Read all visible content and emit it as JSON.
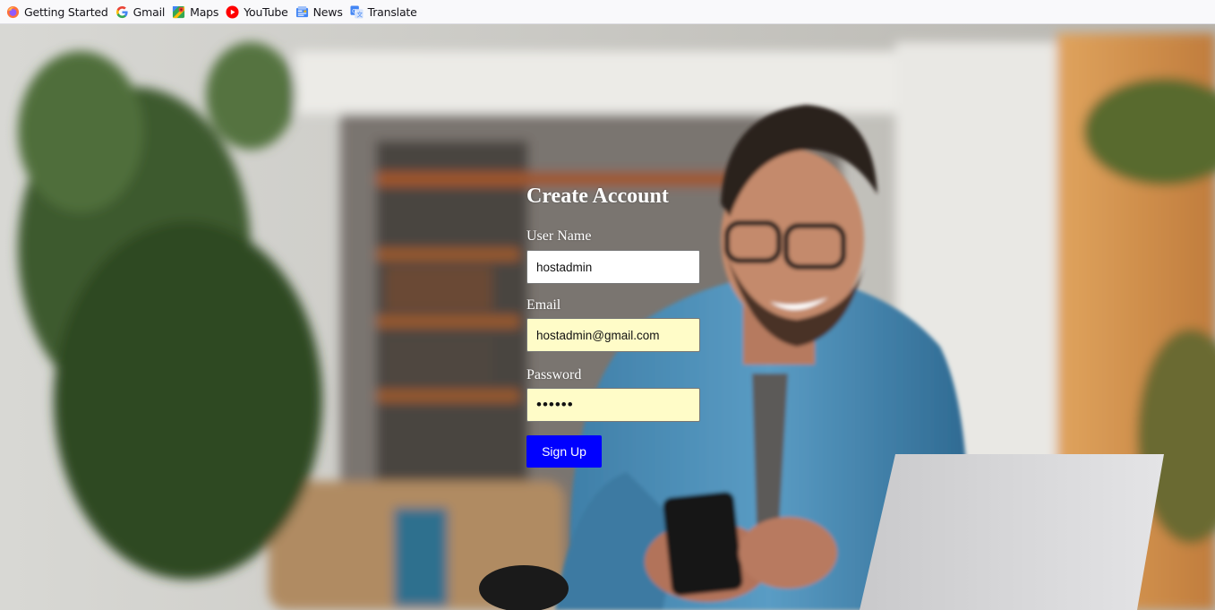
{
  "bookmarks": [
    {
      "label": "Getting Started",
      "icon": "firefox-icon"
    },
    {
      "label": "Gmail",
      "icon": "google-icon"
    },
    {
      "label": "Maps",
      "icon": "maps-icon"
    },
    {
      "label": "YouTube",
      "icon": "youtube-icon"
    },
    {
      "label": "News",
      "icon": "news-icon"
    },
    {
      "label": "Translate",
      "icon": "translate-icon"
    }
  ],
  "form": {
    "title": "Create Account",
    "username": {
      "label": "User Name",
      "value": "hostadmin"
    },
    "email": {
      "label": "Email",
      "value": "hostadmin@gmail.com"
    },
    "password": {
      "label": "Password",
      "value": "hello1"
    },
    "submit_label": "Sign Up"
  },
  "colors": {
    "submit_button": "#0000ff",
    "autofill_field": "#fffcc8",
    "heading_text": "#ffffff"
  }
}
